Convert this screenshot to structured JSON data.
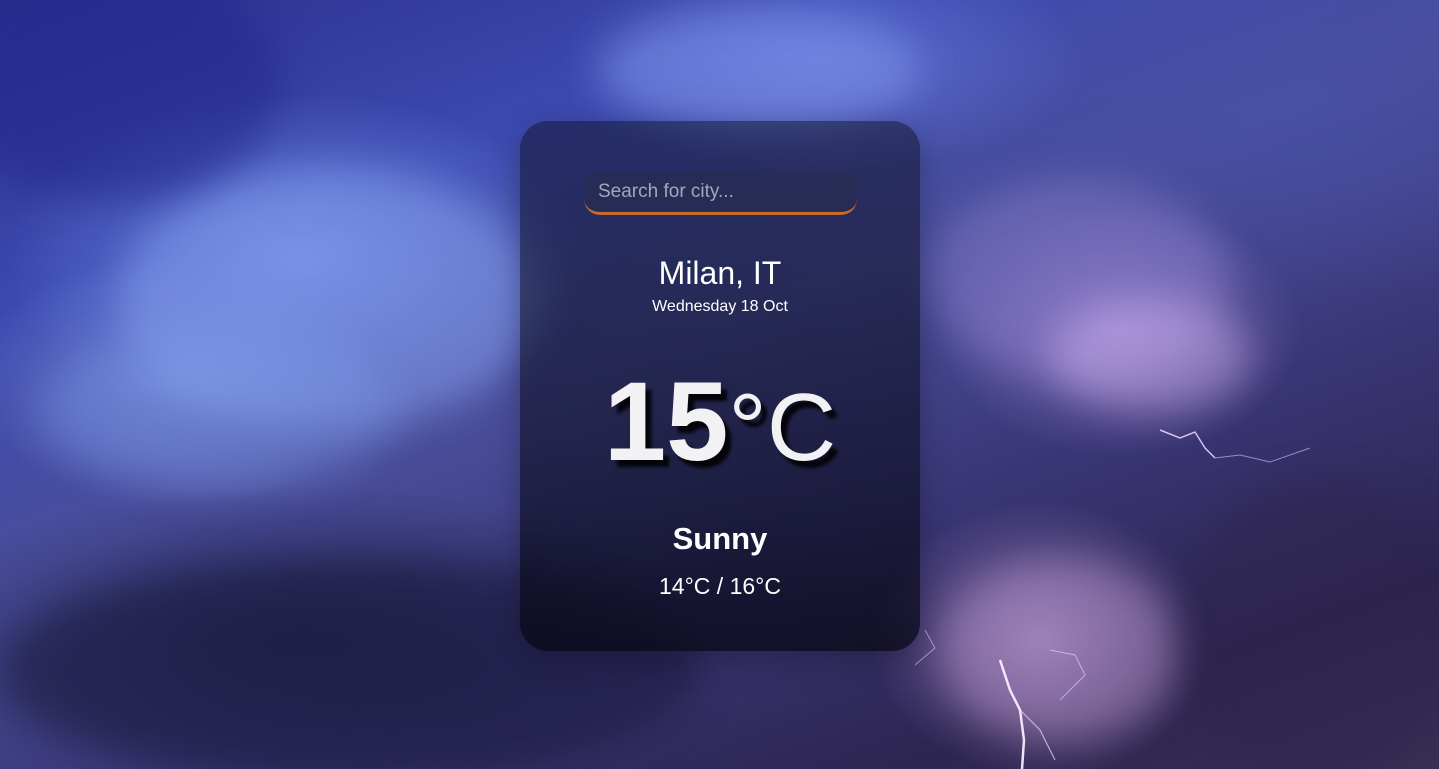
{
  "search": {
    "placeholder": "Search for city...",
    "value": ""
  },
  "location": {
    "city": "Milan, IT",
    "date": "Wednesday 18 Oct"
  },
  "weather": {
    "temperature": "15",
    "unit": "°C",
    "condition": "Sunny",
    "low_high": "14°C / 16°C"
  },
  "colors": {
    "search_underline": "#c86a2a",
    "text": "#ffffff",
    "card_overlay": "rgba(10,12,30,0.42)"
  },
  "background": {
    "description_icon": "storm-clouds-lightning-image"
  }
}
